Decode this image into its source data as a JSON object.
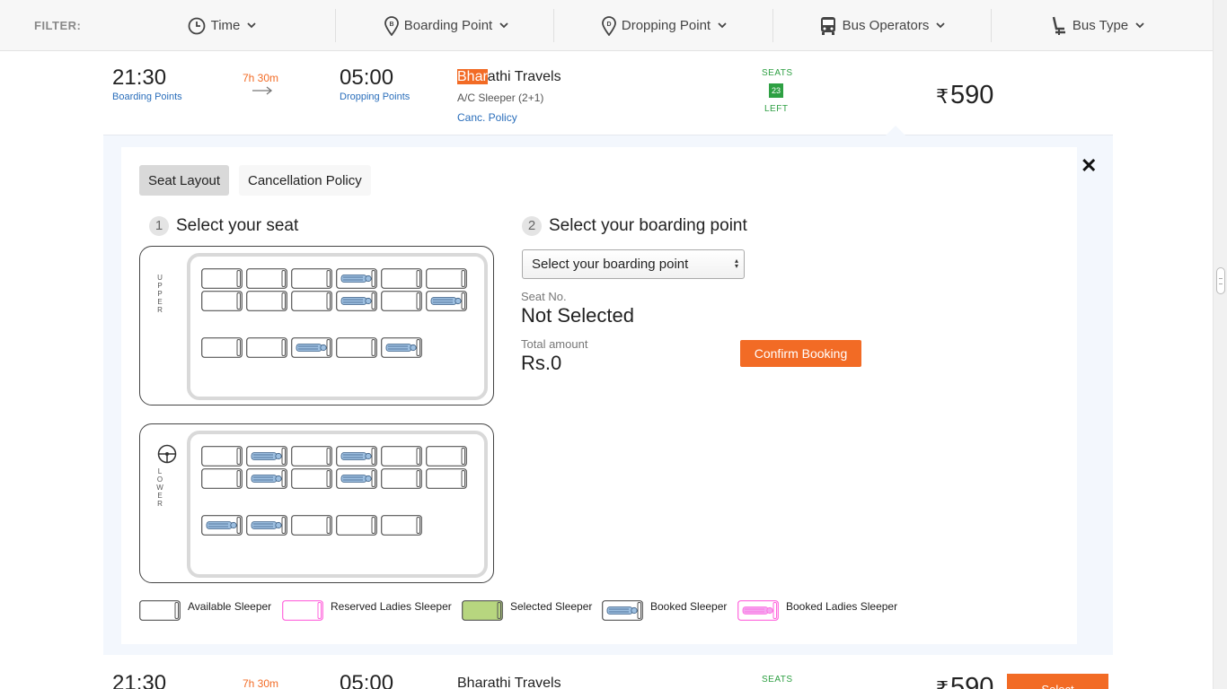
{
  "filters": {
    "label": "FILTER:",
    "items": [
      {
        "label": "Time",
        "icon": "clock-icon"
      },
      {
        "label": "Boarding Point",
        "icon": "map-pin-b-icon"
      },
      {
        "label": "Dropping Point",
        "icon": "map-pin-d-icon"
      },
      {
        "label": "Bus Operators",
        "icon": "bus-icon"
      },
      {
        "label": "Bus Type",
        "icon": "seat-icon"
      }
    ]
  },
  "result": {
    "departure": "21:30",
    "boarding_link": "Boarding Points",
    "duration": "7h 30m",
    "arrival": "05:00",
    "dropping_link": "Dropping Points",
    "operator_highlight": "Bhar",
    "operator_rest": "athi Travels",
    "bus_type": "A/C Sleeper (2+1)",
    "canc_policy": "Canc. Policy",
    "seats_label": "SEATS",
    "seats_count": "23",
    "seats_left": "LEFT",
    "currency": "₹",
    "price": "590"
  },
  "panel": {
    "tabs": [
      "Seat Layout",
      "Cancellation Policy"
    ],
    "step1": {
      "num": "1",
      "title": "Select your seat"
    },
    "step2": {
      "num": "2",
      "title": "Select your boarding point"
    },
    "upper_label": "UPPER",
    "lower_label": "LOWER",
    "boarding_select": "Select your boarding point",
    "seat_no_label": "Seat No.",
    "seat_no_value": "Not Selected",
    "total_label": "Total amount",
    "total_value": "Rs.0",
    "confirm": "Confirm Booking",
    "upper_deck": {
      "row1": [
        "available",
        "available",
        "available",
        "booked",
        "available",
        "available"
      ],
      "row2": [
        "available",
        "available",
        "available",
        "booked",
        "available",
        "booked"
      ],
      "row3": [
        "available",
        "available",
        "booked",
        "available",
        "booked"
      ]
    },
    "lower_deck": {
      "row1": [
        "available",
        "booked",
        "available",
        "booked",
        "available",
        "available"
      ],
      "row2": [
        "available",
        "booked",
        "available",
        "booked",
        "available",
        "available"
      ],
      "row3": [
        "booked",
        "booked",
        "available",
        "available",
        "available"
      ]
    }
  },
  "legend": [
    {
      "label": "Available Sleeper",
      "kind": "available"
    },
    {
      "label": "Reserved Ladies Sleeper",
      "kind": "reserved-ladies"
    },
    {
      "label": "Selected Sleeper",
      "kind": "selected"
    },
    {
      "label": "Booked Sleeper",
      "kind": "booked"
    },
    {
      "label": "Booked Ladies Sleeper",
      "kind": "booked-ladies"
    }
  ],
  "next_result": {
    "departure": "21:30",
    "duration": "7h 30m",
    "arrival": "05:00",
    "operator": "Bharathi Travels",
    "seats_label": "SEATS",
    "currency": "₹",
    "price": "590",
    "select": "Select"
  },
  "colors": {
    "accent": "#f26b25",
    "link": "#2a6ebb",
    "seats": "#2ea043",
    "booked": "#9dbfe0",
    "selected": "#b7d67f",
    "ladies": "#ff66dd"
  }
}
